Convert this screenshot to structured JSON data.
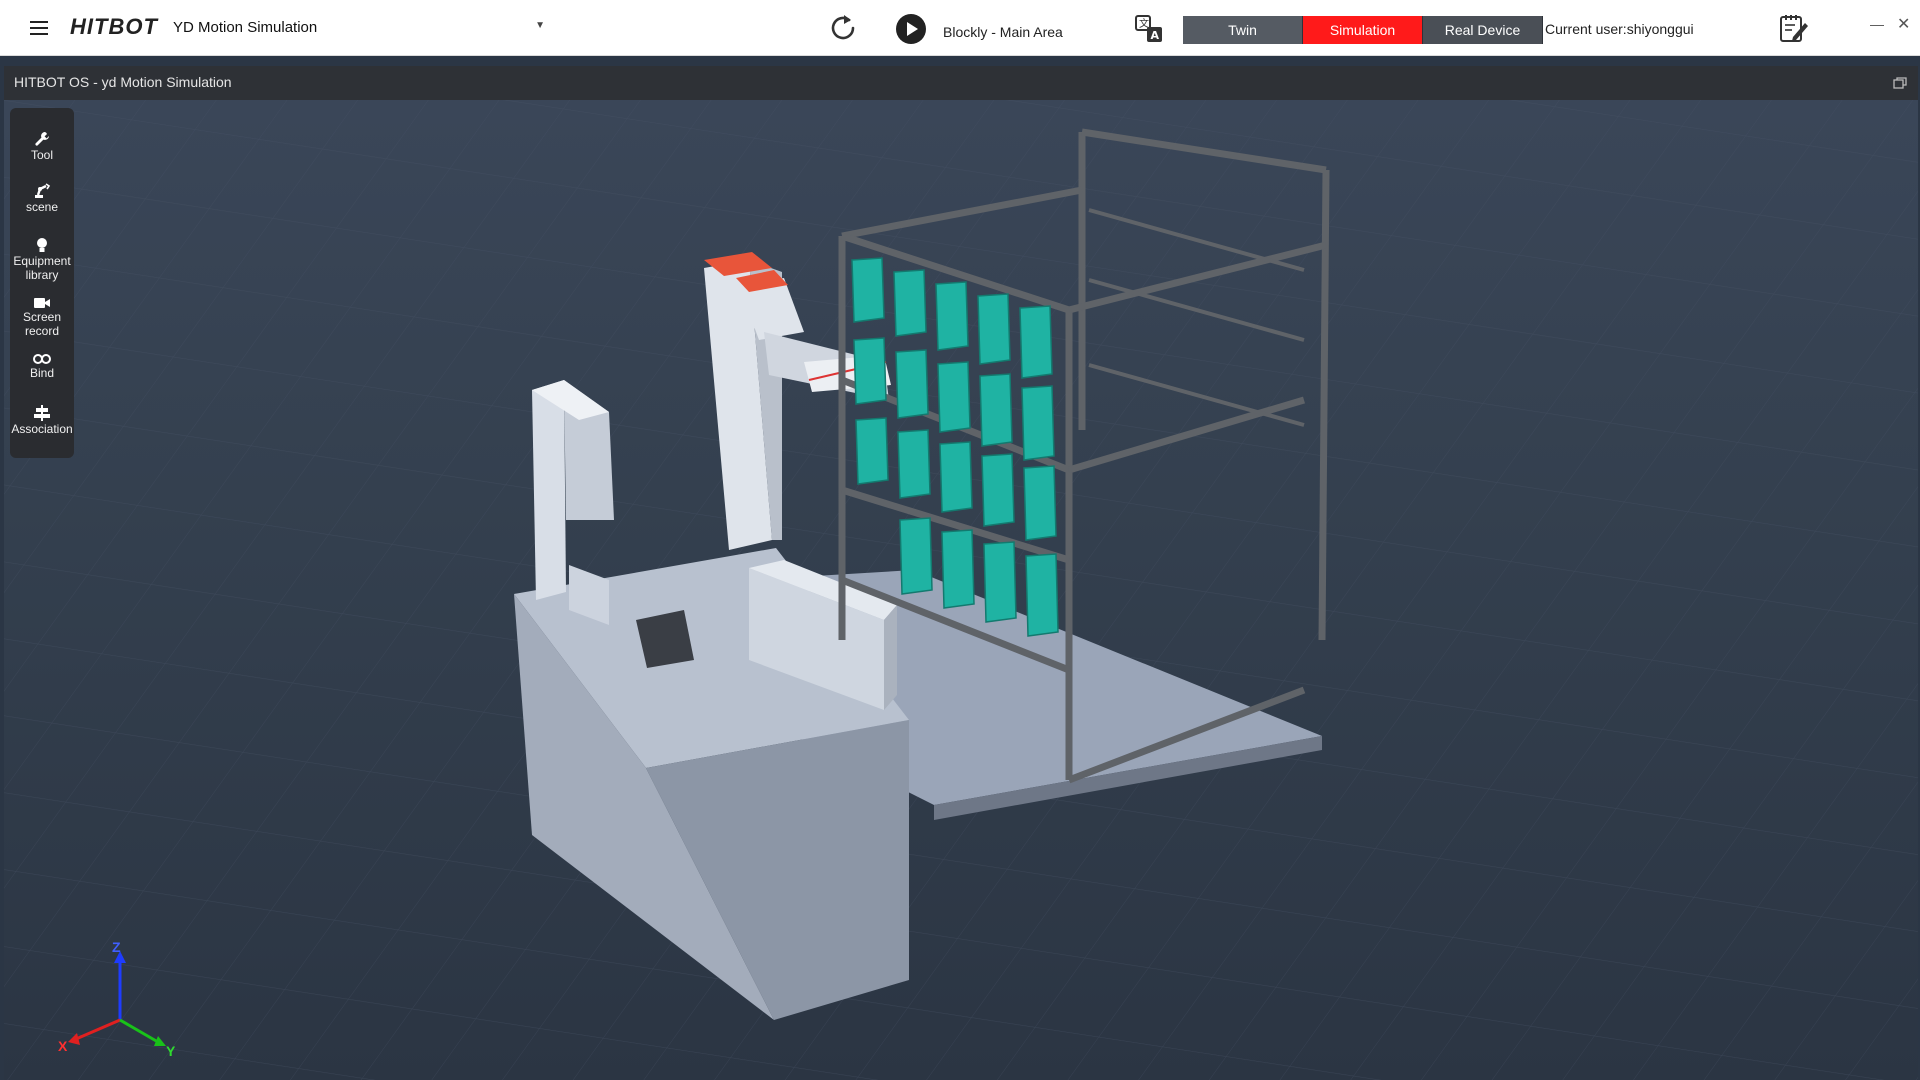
{
  "app": {
    "logo": "HITBOT",
    "project": "YD Motion Simulation",
    "blockly_area": "Blockly - Main Area",
    "current_user": "Current user:shiyonggui",
    "modes": [
      {
        "label": "Twin",
        "active": false
      },
      {
        "label": "Simulation",
        "active": true,
        "color": "#ff1a1a"
      },
      {
        "label": "Real Device",
        "active": false
      }
    ]
  },
  "viewport": {
    "title": "HITBOT OS - yd Motion Simulation"
  },
  "toolbox": {
    "tools": [
      {
        "id": "tool",
        "label": "Tool",
        "icon": "wrench-icon"
      },
      {
        "id": "scene",
        "label": "scene",
        "icon": "robot-arm-icon"
      },
      {
        "id": "equipment",
        "label": "Equipment library",
        "icon": "lightbulb-icon"
      },
      {
        "id": "record",
        "label": "Screen record",
        "icon": "video-camera-icon"
      },
      {
        "id": "bind",
        "label": "Bind",
        "icon": "link-icon"
      },
      {
        "id": "association",
        "label": "Association",
        "icon": "align-icon"
      }
    ]
  },
  "axis": {
    "x": "X",
    "y": "Y",
    "z": "Z"
  },
  "colors": {
    "accent_red": "#ff1a1a",
    "tray_green": "#1fb3a3",
    "robot_orange": "#e8553a",
    "frame_gray": "#5f6368"
  }
}
